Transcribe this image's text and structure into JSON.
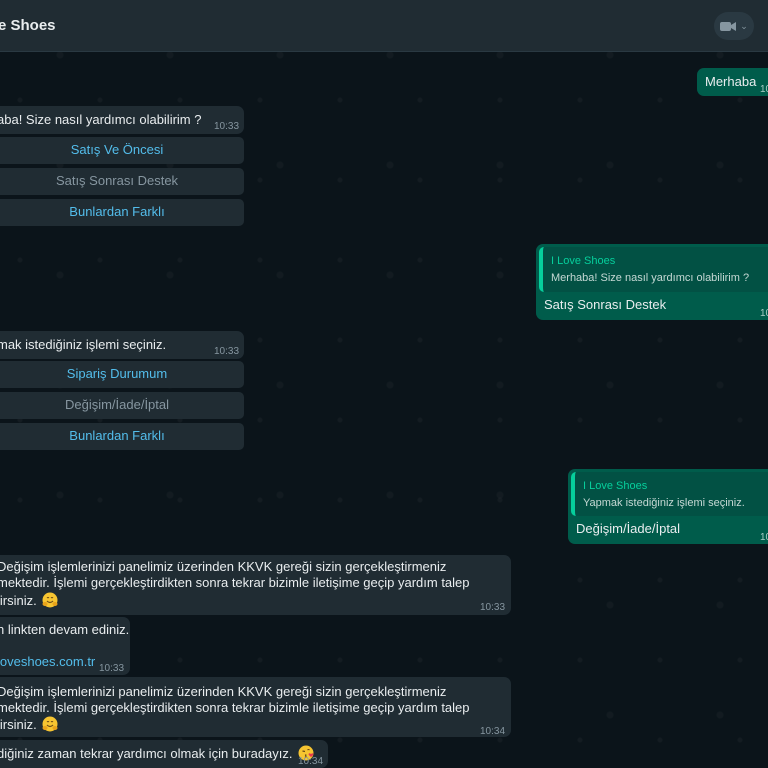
{
  "header": {
    "title": "e Shoes",
    "video_icon": "video-camera-icon",
    "chevron": "⌄"
  },
  "messages": {
    "m1": {
      "text": "Merhaba",
      "time": "10:"
    },
    "m2": {
      "text": "aba! Size nasıl yardımcı olabilirim ?",
      "time": "10:33",
      "options": [
        "Satış Ve Öncesi",
        "Satış Sonrası Destek",
        "Bunlardan Farklı"
      ]
    },
    "m3": {
      "quote_name": "I Love Shoes",
      "quote_text": "Merhaba! Size nasıl yardımcı olabilirim ?",
      "text": "Satış Sonrası Destek",
      "time": "10"
    },
    "m4": {
      "text": "mak istediğiniz işlemi seçiniz.",
      "time": "10:33",
      "options": [
        "Sipariş Durumum",
        "Değişim/İade/İptal",
        "Bunlardan Farklı"
      ]
    },
    "m5": {
      "quote_name": "I Love Shoes",
      "quote_text": "Yapmak istediğiniz işlemi seçiniz.",
      "text": "Değişim/İade/İptal",
      "time": "10"
    },
    "m6": {
      "line1": "Değişim işlemlerinizi panelimiz üzerinden KKVK gereği sizin gerçekleştirmeniz",
      "line2": "mektedir. İşlemi gerçekleştirdikten sonra tekrar bizimle iletişime geçip yardım talep",
      "line3": "lirsiniz.",
      "emoji": "hugging-face-emoji",
      "time": "10:33"
    },
    "m7": {
      "line1": "n linkten devam ediniz.",
      "link": "loveshoes.com.tr",
      "time": "10:33"
    },
    "m8": {
      "line1": "Değişim işlemlerinizi panelimiz üzerinden KKVK gereği sizin gerçekleştirmeniz",
      "line2": "mektedir. İşlemi gerçekleştirdikten sonra tekrar bizimle iletişime geçip yardım talep",
      "line3": "lirsiniz.",
      "emoji": "hugging-face-emoji",
      "time": "10:34"
    },
    "m9": {
      "text": "diğiniz zaman tekrar yardımcı olmak için buradayız.",
      "emoji": "kissing-face-emoji",
      "time": "10:34"
    }
  },
  "colors": {
    "incoming": "#202c33",
    "outgoing": "#005c4b",
    "accent": "#53bdeb",
    "quote": "#06cf9c"
  }
}
